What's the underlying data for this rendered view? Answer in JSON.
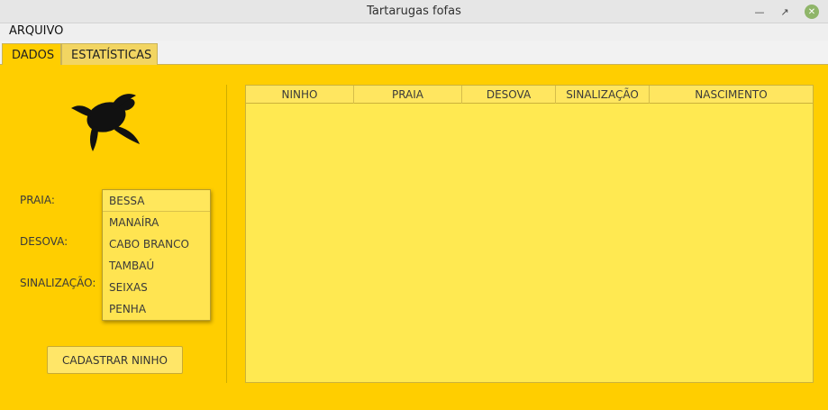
{
  "window": {
    "title": "Tartarugas fofas"
  },
  "menubar": {
    "items": [
      {
        "label": "ARQUIVO"
      }
    ]
  },
  "tabs": [
    {
      "label": "DADOS",
      "active": true
    },
    {
      "label": "ESTATÍSTICAS",
      "active": false
    }
  ],
  "form": {
    "labels": {
      "praia": "PRAIA:",
      "desova": "DESOVA:",
      "sinalizacao": "SINALIZAÇÃO:"
    },
    "praia_dropdown": {
      "selected": "BESSA",
      "options": [
        "BESSA",
        "MANAÍRA",
        "CABO BRANCO",
        "TAMBAÚ",
        "SEIXAS",
        "PENHA"
      ]
    },
    "submit_label": "CADASTRAR NINHO"
  },
  "table": {
    "columns": [
      "NINHO",
      "PRAIA",
      "DESOVA",
      "SINALIZAÇÃO",
      "NASCIMENTO"
    ],
    "rows": []
  },
  "colors": {
    "accent": "#ffce00",
    "table_bg": "#ffe951",
    "close_button": "#8fb569"
  },
  "icons": {
    "logo": "turtle-icon",
    "minimize": "minimize-icon",
    "maximize": "maximize-icon",
    "close": "close-icon"
  }
}
